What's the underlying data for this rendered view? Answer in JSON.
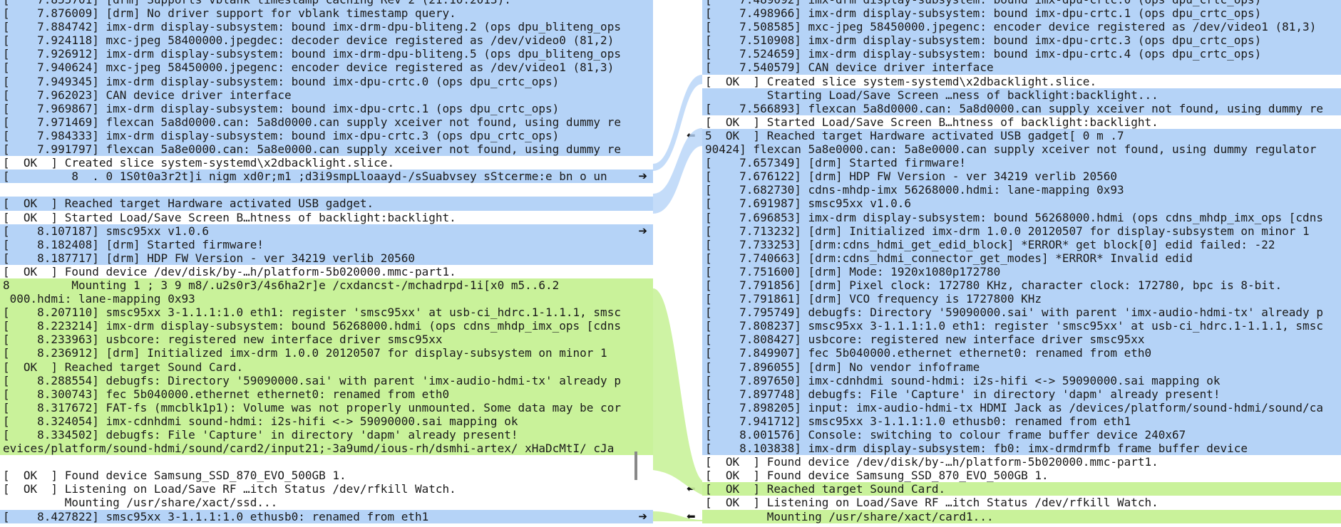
{
  "left_lines": [
    {
      "text": "[    7.855701] [drm] Supports vblank timestamp caching Rev 2 (21.10.2013).",
      "cls": "blue"
    },
    {
      "text": "[    7.876009] [drm] No driver support for vblank timestamp query.",
      "cls": "blue"
    },
    {
      "text": "[    7.884742] imx-drm display-subsystem: bound imx-drm-dpu-bliteng.2 (ops dpu_bliteng_ops",
      "cls": "blue"
    },
    {
      "text": "[    7.924118] mxc-jpeg 58400000.jpegdec: decoder device registered as /dev/video0 (81,2)",
      "cls": "blue"
    },
    {
      "text": "[    7.926912] imx-drm display-subsystem: bound imx-drm-dpu-bliteng.5 (ops dpu_bliteng_ops",
      "cls": "blue"
    },
    {
      "text": "[    7.940624] mxc-jpeg 58450000.jpegenc: encoder device registered as /dev/video1 (81,3)",
      "cls": "blue"
    },
    {
      "text": "[    7.949345] imx-drm display-subsystem: bound imx-dpu-crtc.0 (ops dpu_crtc_ops)",
      "cls": "blue"
    },
    {
      "text": "[    7.962023] CAN device driver interface",
      "cls": "blue"
    },
    {
      "text": "[    7.969867] imx-drm display-subsystem: bound imx-dpu-crtc.1 (ops dpu_crtc_ops)",
      "cls": "blue"
    },
    {
      "text": "[    7.971469] flexcan 5a8d0000.can: 5a8d0000.can supply xceiver not found, using dummy re",
      "cls": "blue"
    },
    {
      "text": "[    7.984333] imx-drm display-subsystem: bound imx-dpu-crtc.3 (ops dpu_crtc_ops)",
      "cls": "blue"
    },
    {
      "text": "[    7.991797] flexcan 5a8e0000.can: 5a8e0000.can supply xceiver not found, using dummy re",
      "cls": "blue"
    },
    {
      "text": "[  OK  ] Created slice system-systemd\\x2dbacklight.slice.",
      "cls": "white"
    },
    {
      "text": "[         8  . 0 1S0t0a3r2t]i nigm xd0r;m1 ;d3i9smpLloaayd-/sSuabvsey sStcerme:e bn o un",
      "cls": "blue",
      "arrow": "right"
    },
    {
      "text": "",
      "cls": "gap"
    },
    {
      "text": "[  OK  ] Reached target Hardware activated USB gadget.",
      "cls": "blue"
    },
    {
      "text": "[  OK  ] Started Load/Save Screen B…htness of backlight:backlight.",
      "cls": "white"
    },
    {
      "text": "[    8.107187] smsc95xx v1.0.6",
      "cls": "blue",
      "arrow": "right"
    },
    {
      "text": "[    8.182408] [drm] Started firmware!",
      "cls": "blue"
    },
    {
      "text": "[    8.187717] [drm] HDP FW Version - ver 34219 verlib 20560",
      "cls": "blue"
    },
    {
      "text": "[  OK  ] Found device /dev/disk/by-…h/platform-5b020000.mmc-part1.",
      "cls": "white"
    },
    {
      "text": "8         Mounting 1 ; 3 9 m8/.u2s0r3/4s6ha2r]e /cxdancst-/mchadrpd-1i[x0 m5..6.2",
      "cls": "green"
    },
    {
      "text": " 000.hdmi: lane-mapping 0x93",
      "cls": "green"
    },
    {
      "text": "[    8.207110] smsc95xx 3-1.1.1:1.0 eth1: register 'smsc95xx' at usb-ci_hdrc.1-1.1.1, smsc",
      "cls": "green"
    },
    {
      "text": "[    8.223214] imx-drm display-subsystem: bound 56268000.hdmi (ops cdns_mhdp_imx_ops [cdns",
      "cls": "green"
    },
    {
      "text": "[    8.233963] usbcore: registered new interface driver smsc95xx",
      "cls": "green"
    },
    {
      "text": "[    8.236912] [drm] Initialized imx-drm 1.0.0 20120507 for display-subsystem on minor 1",
      "cls": "green"
    },
    {
      "text": "[  OK  ] Reached target Sound Card.",
      "cls": "green"
    },
    {
      "text": "[    8.288554] debugfs: Directory '59090000.sai' with parent 'imx-audio-hdmi-tx' already p",
      "cls": "green"
    },
    {
      "text": "[    8.300743] fec 5b040000.ethernet ethernet0: renamed from eth0",
      "cls": "green"
    },
    {
      "text": "[    8.317672] FAT-fs (mmcblk1p1): Volume was not properly unmounted. Some data may be cor",
      "cls": "green"
    },
    {
      "text": "[    8.324054] imx-cdnhdmi sound-hdmi: i2s-hifi <-> 59090000.sai mapping ok",
      "cls": "green"
    },
    {
      "text": "[    8.334502] debugfs: File 'Capture' in directory 'dapm' already present!",
      "cls": "green"
    },
    {
      "text": "evices/platform/sound-hdmi/sound/card2/input21;-3a9umd/ious-rh/dsmhi-artex/ xHaDcMtI/ cJa",
      "cls": "green"
    },
    {
      "text": "",
      "cls": "gap"
    },
    {
      "text": "[  OK  ] Found device Samsung_SSD_870_EVO_500GB 1.",
      "cls": "white"
    },
    {
      "text": "[  OK  ] Listening on Load/Save RF …itch Status /dev/rfkill Watch.",
      "cls": "white"
    },
    {
      "text": "         Mounting /usr/share/xact/ssd...",
      "cls": "white"
    },
    {
      "text": "[    8.427822] smsc95xx 3-1.1.1:1.0 ethusb0: renamed from eth1",
      "cls": "blue",
      "arrow": "right"
    }
  ],
  "right_lines": [
    {
      "text": "[    7.489092] imx-drm display-subsystem: bound imx-dpu-crtc.0 (ops dpu_crtc_ops)",
      "cls": "blue"
    },
    {
      "text": "[    7.498966] imx-drm display-subsystem: bound imx-dpu-crtc.1 (ops dpu_crtc_ops)",
      "cls": "blue"
    },
    {
      "text": "[    7.508585] mxc-jpeg 58450000.jpegenc: encoder device registered as /dev/video1 (81,3)",
      "cls": "blue"
    },
    {
      "text": "[    7.510908] imx-drm display-subsystem: bound imx-dpu-crtc.3 (ops dpu_crtc_ops)",
      "cls": "blue"
    },
    {
      "text": "[    7.524659] imx-drm display-subsystem: bound imx-dpu-crtc.4 (ops dpu_crtc_ops)",
      "cls": "blue"
    },
    {
      "text": "[    7.540579] CAN device driver interface",
      "cls": "blue"
    },
    {
      "text": "[  OK  ] Created slice system-systemd\\x2dbacklight.slice.",
      "cls": "white"
    },
    {
      "text": "         Starting Load/Save Screen …ness of backlight:backlight...",
      "cls": "blue"
    },
    {
      "text": "[    7.566893] flexcan 5a8d0000.can: 5a8d0000.can supply xceiver not found, using dummy re",
      "cls": "blue"
    },
    {
      "text": "[  OK  ] Started Load/Save Screen B…htness of backlight:backlight.",
      "cls": "white"
    },
    {
      "text": "5  OK  ] Reached target Hardware activated USB gadget[ 0 m .7",
      "cls": "blue",
      "arrow": "left"
    },
    {
      "text": "90424] flexcan 5a8e0000.can: 5a8e0000.can supply xceiver not found, using dummy regulator",
      "cls": "blue"
    },
    {
      "text": "[    7.657349] [drm] Started firmware!",
      "cls": "blue"
    },
    {
      "text": "[    7.676122] [drm] HDP FW Version - ver 34219 verlib 20560",
      "cls": "blue"
    },
    {
      "text": "[    7.682730] cdns-mhdp-imx 56268000.hdmi: lane-mapping 0x93",
      "cls": "blue"
    },
    {
      "text": "[    7.691987] smsc95xx v1.0.6",
      "cls": "blue"
    },
    {
      "text": "[    7.696853] imx-drm display-subsystem: bound 56268000.hdmi (ops cdns_mhdp_imx_ops [cdns",
      "cls": "blue"
    },
    {
      "text": "[    7.713232] [drm] Initialized imx-drm 1.0.0 20120507 for display-subsystem on minor 1",
      "cls": "blue"
    },
    {
      "text": "[    7.733253] [drm:cdns_hdmi_get_edid_block] *ERROR* get block[0] edid failed: -22",
      "cls": "blue"
    },
    {
      "text": "[    7.740663] [drm:cdns_hdmi_connector_get_modes] *ERROR* Invalid edid",
      "cls": "blue"
    },
    {
      "text": "[    7.751600] [drm] Mode: 1920x1080p172780",
      "cls": "blue"
    },
    {
      "text": "[    7.791856] [drm] Pixel clock: 172780 KHz, character clock: 172780, bpc is 8-bit.",
      "cls": "blue"
    },
    {
      "text": "[    7.791861] [drm] VCO frequency is 1727800 KHz",
      "cls": "blue"
    },
    {
      "text": "[    7.795749] debugfs: Directory '59090000.sai' with parent 'imx-audio-hdmi-tx' already p",
      "cls": "blue"
    },
    {
      "text": "[    7.808237] smsc95xx 3-1.1.1:1.0 eth1: register 'smsc95xx' at usb-ci_hdrc.1-1.1.1, smsc",
      "cls": "blue"
    },
    {
      "text": "[    7.808427] usbcore: registered new interface driver smsc95xx",
      "cls": "blue"
    },
    {
      "text": "[    7.849907] fec 5b040000.ethernet ethernet0: renamed from eth0",
      "cls": "blue"
    },
    {
      "text": "[    7.896055] [drm] No vendor infoframe",
      "cls": "blue"
    },
    {
      "text": "[    7.897650] imx-cdnhdmi sound-hdmi: i2s-hifi <-> 59090000.sai mapping ok",
      "cls": "blue"
    },
    {
      "text": "[    7.897748] debugfs: File 'Capture' in directory 'dapm' already present!",
      "cls": "blue"
    },
    {
      "text": "[    7.898205] input: imx-audio-hdmi-tx HDMI Jack as /devices/platform/sound-hdmi/sound/ca",
      "cls": "blue"
    },
    {
      "text": "[    7.941712] smsc95xx 3-1.1.1:1.0 ethusb0: renamed from eth1",
      "cls": "blue"
    },
    {
      "text": "[    8.001576] Console: switching to colour frame buffer device 240x67",
      "cls": "blue"
    },
    {
      "text": "[    8.103838] imx-drm display-subsystem: fb0: imx-drmdrmfb frame buffer device",
      "cls": "blue"
    },
    {
      "text": "[  OK  ] Found device /dev/disk/by-…h/platform-5b020000.mmc-part1.",
      "cls": "white"
    },
    {
      "text": "[  OK  ] Found device Samsung_SSD_870_EVO_500GB 1.",
      "cls": "white"
    },
    {
      "text": "[  OK  ] Reached target Sound Card.",
      "cls": "green",
      "arrow": "left"
    },
    {
      "text": "[  OK  ] Listening on Load/Save RF …itch Status /dev/rfkill Watch.",
      "cls": "white"
    },
    {
      "text": "         Mounting /usr/share/xact/card1...",
      "cls": "green",
      "arrow": "left"
    }
  ],
  "arrow_glyphs": {
    "right": "➔",
    "left": "⬅"
  },
  "return_glyph": "↵",
  "colors": {
    "blue": "#b5d3f7",
    "green": "#c9f29a",
    "highlight": "#8ebcf2"
  }
}
